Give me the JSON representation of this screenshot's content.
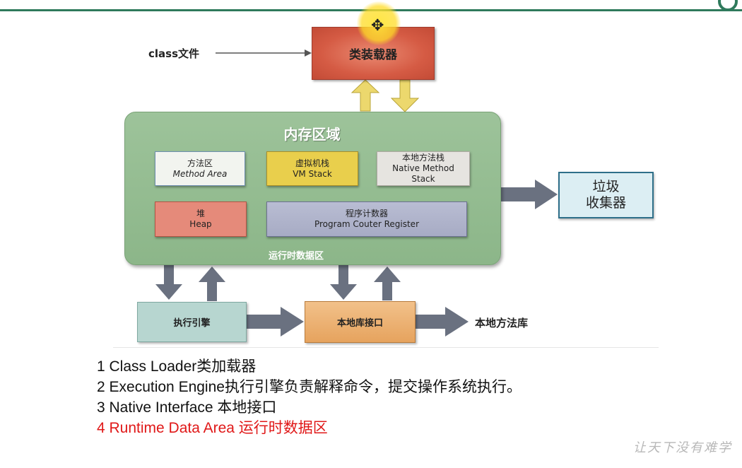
{
  "diagram": {
    "class_file": "class文件",
    "class_loader": "类装载器",
    "memory_area_title": "内存区域",
    "runtime_data_area": "运行时数据区",
    "method_area": {
      "cn": "方法区",
      "en": "Method Area"
    },
    "vm_stack": {
      "cn": "虚拟机栈",
      "en": "VM Stack"
    },
    "native_method_stack": {
      "cn": "本地方法栈",
      "en1": "Native Method",
      "en2": "Stack"
    },
    "heap": {
      "cn": "堆",
      "en": "Heap"
    },
    "program_counter": {
      "cn": "程序计数器",
      "en": "Program Couter Register"
    },
    "garbage_collector": {
      "line1": "垃圾",
      "line2": "收集器"
    },
    "execution_engine": "执行引擎",
    "native_interface": "本地库接口",
    "native_library": "本地方法库"
  },
  "notes": [
    "1 Class Loader类加载器",
    "2 Execution Engine执行引擎负责解释命令，提交操作系统执行。",
    "3 Native Interface 本地接口",
    "4 Runtime Data Area 运行时数据区"
  ],
  "colors": {
    "accent": "#2f7a5c",
    "highlight": "#e01818",
    "arrow": "#6a7180"
  },
  "watermark": "让天下没有难学"
}
